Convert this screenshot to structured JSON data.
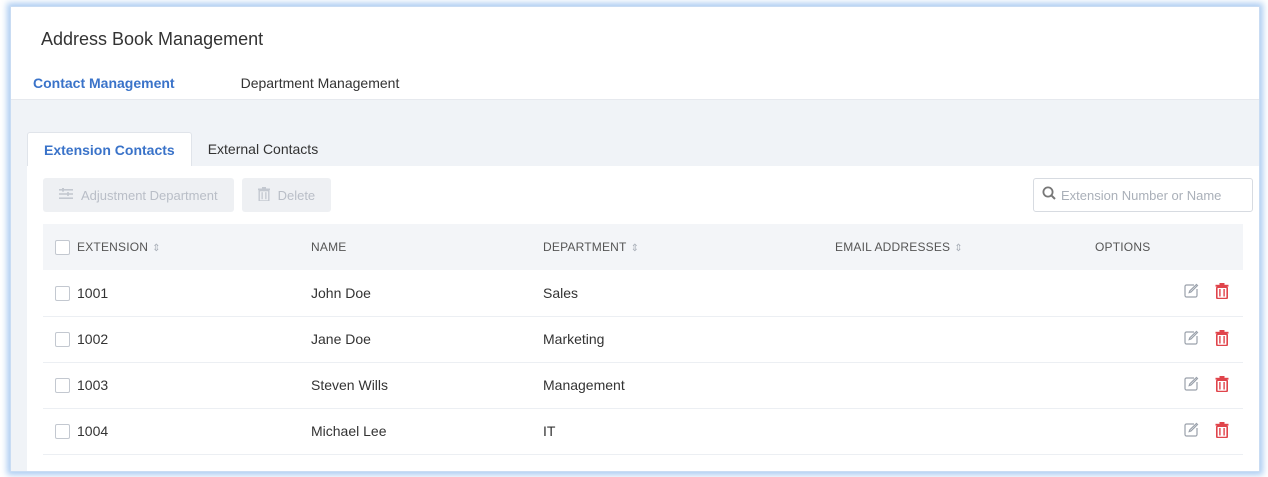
{
  "page": {
    "title": "Address Book Management"
  },
  "top_tabs": [
    {
      "label": "Contact Management",
      "active": true
    },
    {
      "label": "Department Management",
      "active": false
    }
  ],
  "sub_tabs": [
    {
      "label": "Extension Contacts",
      "active": true
    },
    {
      "label": "External Contacts",
      "active": false
    }
  ],
  "toolbar": {
    "adjust_label": "Adjustment Department",
    "delete_label": "Delete",
    "adjust_icon": "list-adjust-icon",
    "delete_icon": "trash-icon"
  },
  "search": {
    "placeholder": "Extension Number or Name",
    "icon": "search-icon"
  },
  "table": {
    "columns": [
      "EXTENSION",
      "NAME",
      "DEPARTMENT",
      "EMAIL ADDRESSES",
      "OPTIONS"
    ],
    "sort_glyph": "⇕",
    "rows": [
      {
        "extension": "1001",
        "name": "John Doe",
        "department": "Sales",
        "email": ""
      },
      {
        "extension": "1002",
        "name": "Jane Doe",
        "department": "Marketing",
        "email": ""
      },
      {
        "extension": "1003",
        "name": "Steven Wills",
        "department": "Management",
        "email": ""
      },
      {
        "extension": "1004",
        "name": "Michael Lee",
        "department": "IT",
        "email": ""
      }
    ]
  },
  "colors": {
    "accent": "#3a73c9",
    "delete_icon": "#e0444b",
    "edit_icon": "#9aa1ab"
  }
}
